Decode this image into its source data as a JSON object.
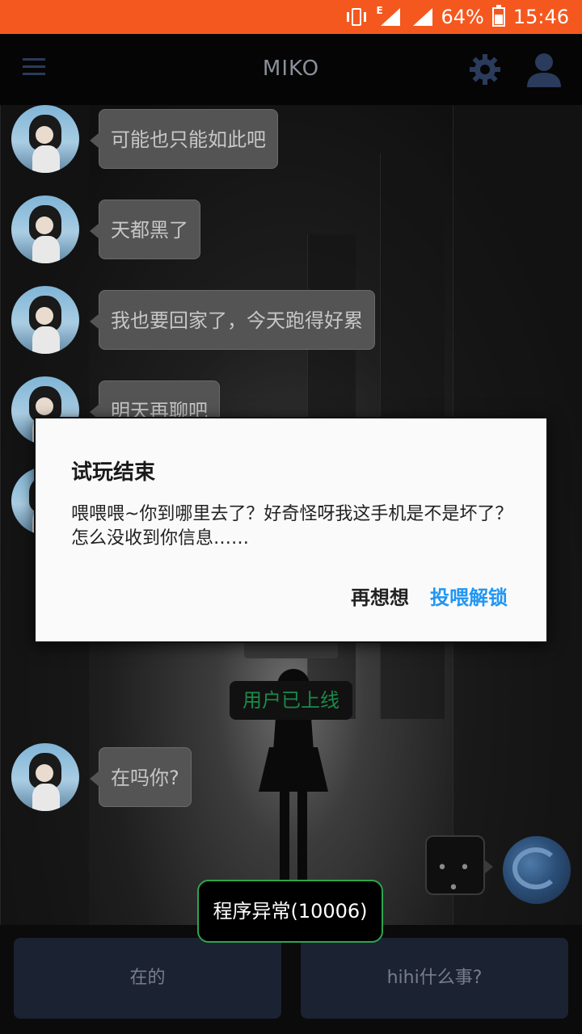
{
  "status_bar": {
    "network_label": "E",
    "battery_percent": "64%",
    "time": "15:46",
    "icons": [
      "vibrate-icon",
      "signal-icon",
      "signal-icon",
      "battery-charging-icon"
    ]
  },
  "app_bar": {
    "title": "MIKO",
    "icons": [
      "menu-icon",
      "gear-icon",
      "user-icon"
    ],
    "accent_color": "#2a3b5c"
  },
  "messages": [
    {
      "text": "可能也只能如此吧"
    },
    {
      "text": "天都黑了"
    },
    {
      "text": "我也要回家了，今天跑得好累"
    },
    {
      "text": "明天再聊吧"
    },
    {
      "text": "在吗你?"
    }
  ],
  "system": {
    "online_text": "用户已上线",
    "online_color": "#1b8a48"
  },
  "typing_indicator": "• • •",
  "dialog": {
    "title": "试玩结束",
    "body": "喂喂喂~你到哪里去了？好奇怪呀我这手机是不是坏了？怎么没收到你信息……",
    "cancel_label": "再想想",
    "confirm_label": "投喂解锁",
    "confirm_color": "#2196f3"
  },
  "toast": {
    "text": "程序异常(10006)",
    "border_color": "#2ea44f"
  },
  "replies": [
    {
      "label": "在的"
    },
    {
      "label": "hihi什么事?"
    }
  ],
  "status_bar_color": "#f4581e"
}
